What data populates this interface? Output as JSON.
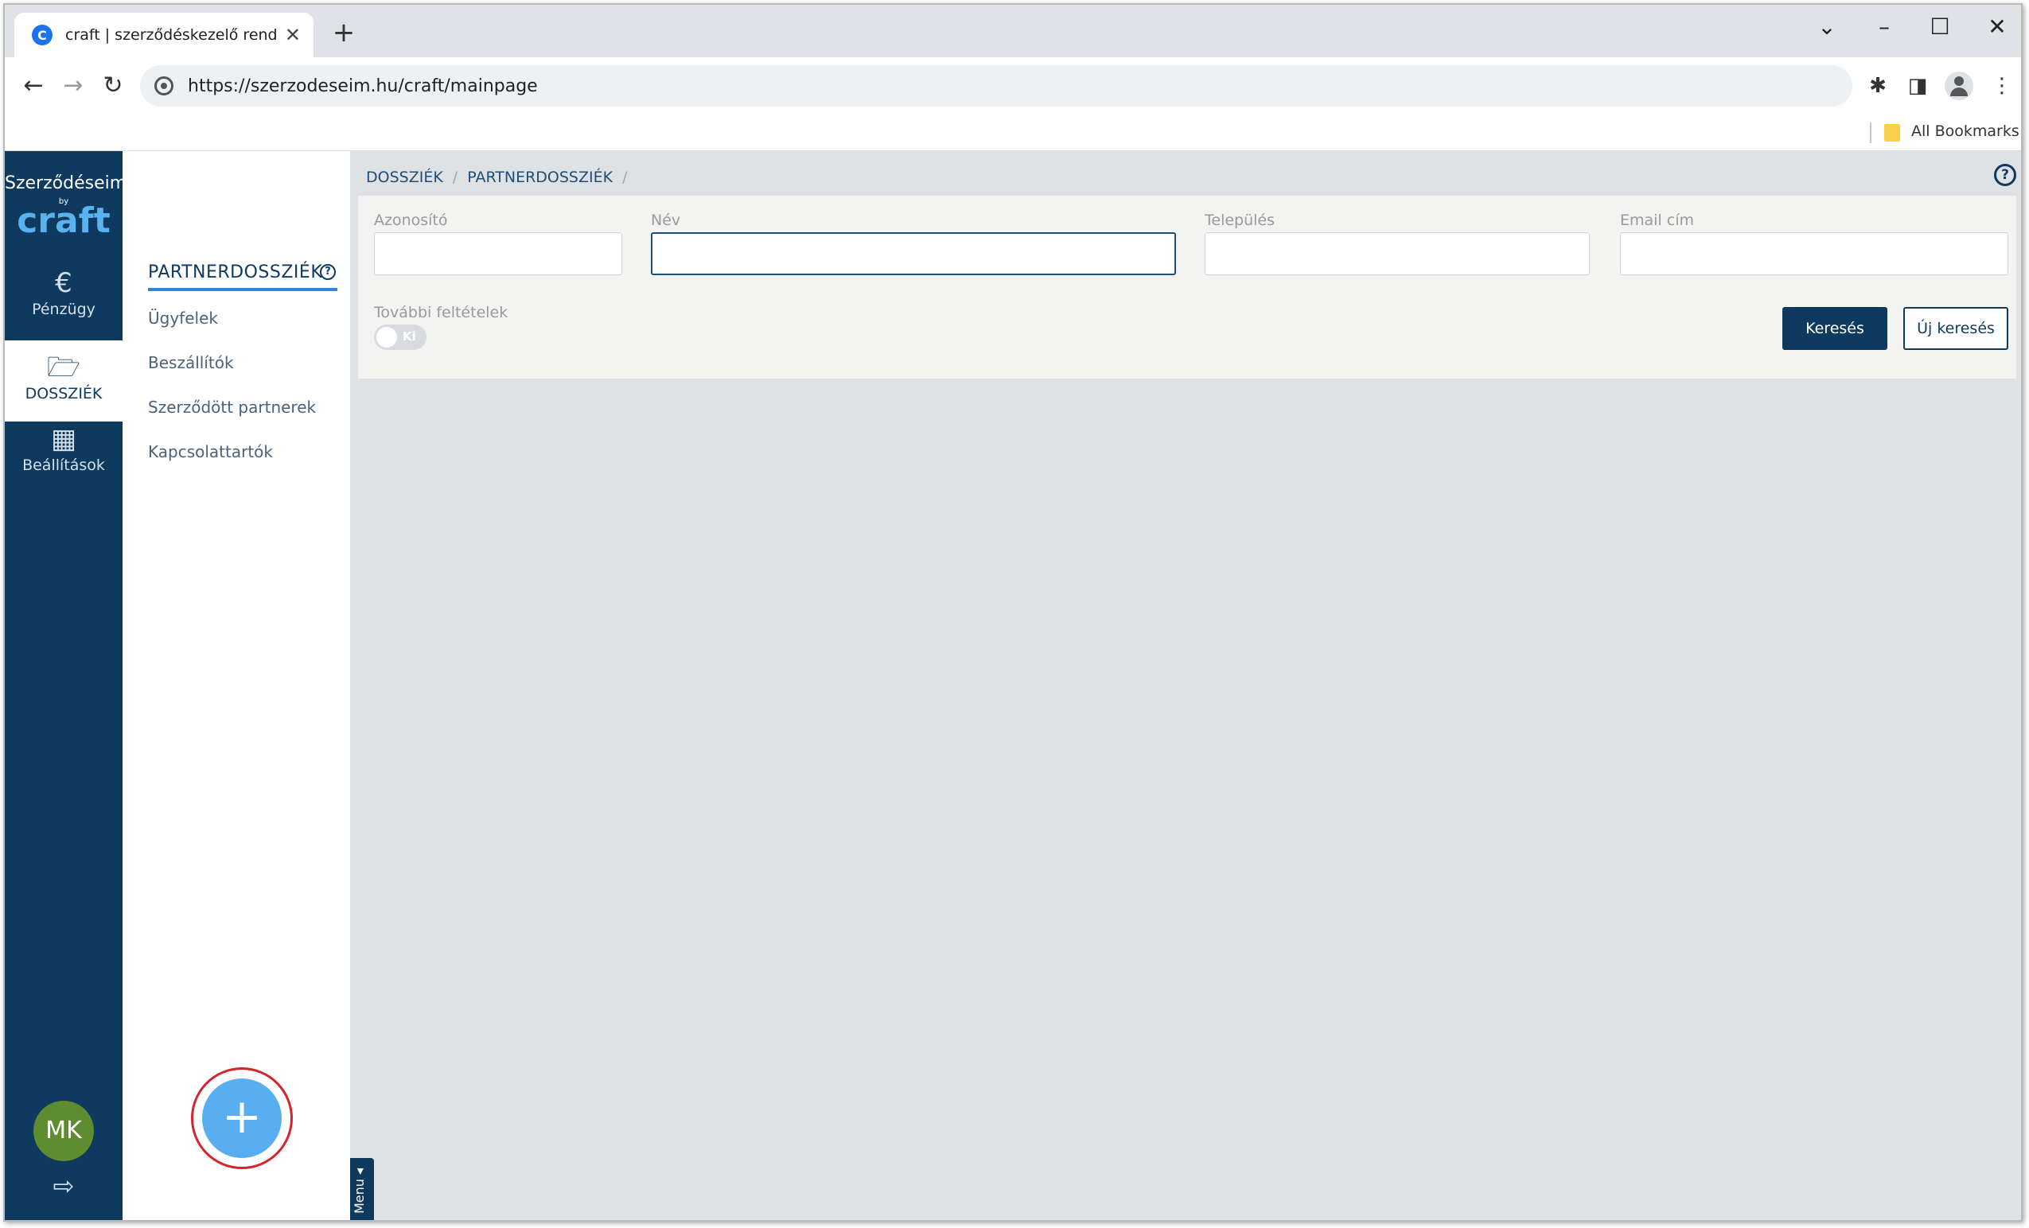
{
  "browser": {
    "tab_title": "craft | szerződéskezelő rendszer",
    "favicon_letter": "C",
    "url": "https://szerzodeseim.hu/craft/mainpage",
    "bookmarks_label": "All Bookmarks"
  },
  "sidebar": {
    "logo_top": "Szerződéseim",
    "logo_by": "by",
    "logo_craft": "craft",
    "items": [
      {
        "label": "Pénzügy",
        "icon": "euro-icon"
      },
      {
        "label": "DOSSZIÉK",
        "icon": "folder-open-icon",
        "active": true
      },
      {
        "label": "Beállítások",
        "icon": "building-icon"
      }
    ],
    "avatar_initials": "MK"
  },
  "subnav": {
    "title": "PARTNERDOSSZIÉK",
    "items": [
      "Ügyfelek",
      "Beszállítók",
      "Szerződött partnerek",
      "Kapcsolattartók"
    ]
  },
  "breadcrumb": [
    "DOSSZIÉK",
    "PARTNERDOSSZIÉK"
  ],
  "filters": {
    "fields": [
      {
        "label": "Azonosító",
        "value": ""
      },
      {
        "label": "Név",
        "value": ""
      },
      {
        "label": "Település",
        "value": ""
      },
      {
        "label": "Email cím",
        "value": ""
      }
    ],
    "more_label": "További feltételek",
    "toggle_text": "Ki",
    "search_label": "Keresés",
    "reset_label": "Új keresés"
  },
  "menu_tab_label": "Menu ◂",
  "colors": {
    "primary": "#0d3a5e",
    "accent": "#2f86d6",
    "fab": "#58aef0"
  }
}
